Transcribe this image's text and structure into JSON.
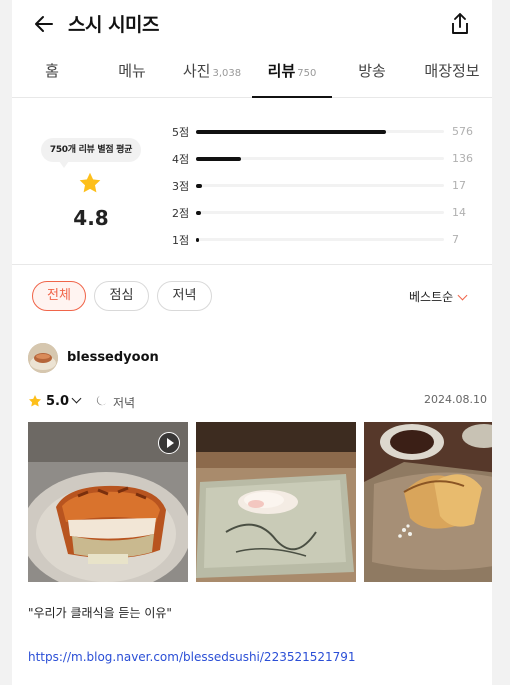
{
  "header": {
    "title": "스시 시미즈",
    "back_icon": "arrow-left-icon",
    "share_icon": "share-icon"
  },
  "tabs": [
    {
      "label": "홈",
      "count": ""
    },
    {
      "label": "메뉴",
      "count": ""
    },
    {
      "label": "사진",
      "count": "3,038"
    },
    {
      "label": "리뷰",
      "count": "750",
      "active": true
    },
    {
      "label": "방송",
      "count": ""
    },
    {
      "label": "매장정보",
      "count": ""
    }
  ],
  "rating_summary": {
    "bubble_text": "750개 리뷰 별점 평균",
    "average": "4.8",
    "star_color": "#fdbf1b",
    "distribution": [
      {
        "label": "5점",
        "count": "576",
        "fraction": 0.768
      },
      {
        "label": "4점",
        "count": "136",
        "fraction": 0.181
      },
      {
        "label": "3점",
        "count": "17",
        "fraction": 0.023
      },
      {
        "label": "2점",
        "count": "14",
        "fraction": 0.019
      },
      {
        "label": "1점",
        "count": "7",
        "fraction": 0.009
      }
    ]
  },
  "filters": {
    "chips": [
      {
        "label": "전체",
        "active": true
      },
      {
        "label": "점심",
        "active": false
      },
      {
        "label": "저녁",
        "active": false
      }
    ],
    "sort_label": "베스트순",
    "accent": "#f0654a"
  },
  "review": {
    "username": "blessedyoon",
    "score": "5.0",
    "meal": "저녁",
    "date": "2024.08.10",
    "text": "\"우리가 클래식을 듣는 이유\"",
    "link": "https://m.blog.naver.com/blessedsushi/223521521791",
    "link_color": "#2b4fd6"
  }
}
